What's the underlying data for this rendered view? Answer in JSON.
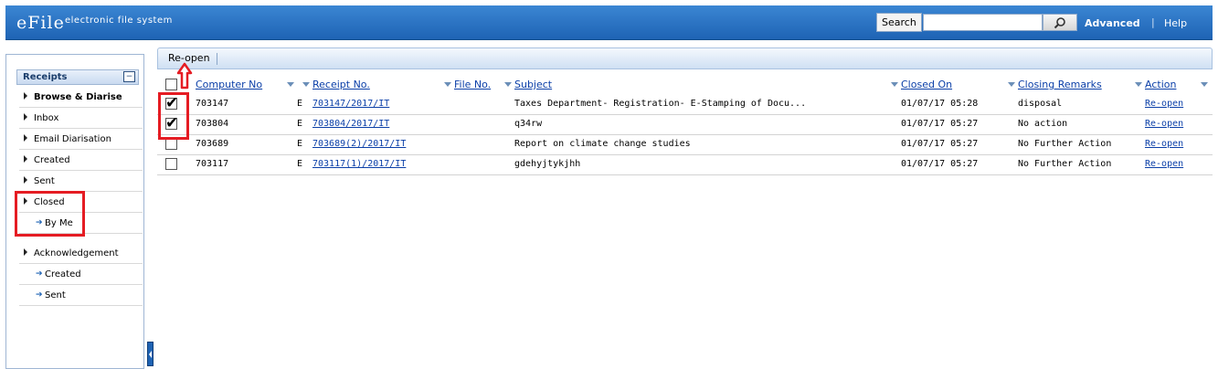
{
  "header": {
    "brand": "eFile",
    "brand_sub": "electronic file system",
    "search_label": "Search",
    "search_value": "",
    "advanced": "Advanced",
    "separator": "|",
    "help": "Help"
  },
  "sidebar": {
    "section": "Receipts",
    "items": [
      {
        "label": "Browse & Diarise"
      },
      {
        "label": "Inbox"
      },
      {
        "label": "Email Diarisation"
      },
      {
        "label": "Created"
      },
      {
        "label": "Sent"
      },
      {
        "label": "Closed"
      },
      {
        "label": "By Me"
      },
      {
        "label": "Acknowledgement"
      },
      {
        "label": "Created"
      },
      {
        "label": "Sent"
      }
    ]
  },
  "toolbar": {
    "reopen_label": "Re-open",
    "separator": "|"
  },
  "table": {
    "columns": [
      "Computer No",
      "Receipt No.",
      "File No.",
      "Subject",
      "Closed On",
      "Closing Remarks",
      "Action"
    ],
    "rows": [
      {
        "computer_no": "703147",
        "type": "E",
        "receipt_no": "703147/2017/IT",
        "file_no": "",
        "subject": "Taxes Department- Registration- E-Stamping of Docu...",
        "closed_on": "01/07/17 05:28",
        "remarks": "disposal",
        "action": "Re-open",
        "checked": true
      },
      {
        "computer_no": "703804",
        "type": "E",
        "receipt_no": "703804/2017/IT",
        "file_no": "",
        "subject": "q34rw",
        "closed_on": "01/07/17 05:27",
        "remarks": "No action",
        "action": "Re-open",
        "checked": true
      },
      {
        "computer_no": "703689",
        "type": "E",
        "receipt_no": "703689(2)/2017/IT",
        "file_no": "",
        "subject": "Report on climate change studies",
        "closed_on": "01/07/17 05:27",
        "remarks": "No Further Action",
        "action": "Re-open",
        "checked": false
      },
      {
        "computer_no": "703117",
        "type": "E",
        "receipt_no": "703117(1)/2017/IT",
        "file_no": "",
        "subject": "gdehyjtykjhh",
        "closed_on": "01/07/17 05:27",
        "remarks": "No Further Action",
        "action": "Re-open",
        "checked": false
      }
    ]
  },
  "colors": {
    "header": "#2a74c8",
    "link": "#0b3fa8",
    "highlight": "#e51c23"
  }
}
